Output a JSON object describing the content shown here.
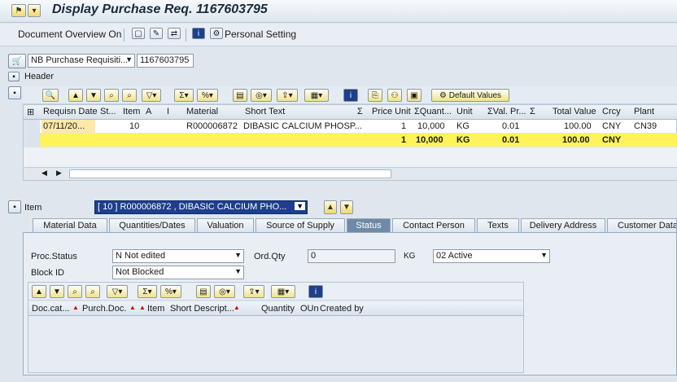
{
  "window": {
    "title": "Display Purchase Req. 1167603795"
  },
  "appbar": {
    "doc_overview": "Document Overview On",
    "personal_setting": "Personal Setting"
  },
  "header": {
    "doc_type": "NB Purchase Requisiti...",
    "doc_number": "1167603795",
    "header_label": "Header"
  },
  "alv": {
    "default_values": "Default Values"
  },
  "grid": {
    "columns": [
      "Requisn Date",
      "St...",
      "Item",
      "A",
      "I",
      "Material",
      "Short Text",
      "Σ",
      "Price Unit",
      "ΣQuant...",
      "Unit",
      "ΣVal. Pr...",
      "Σ",
      "Total Value",
      "Crcy",
      "Plant"
    ],
    "rows": [
      {
        "date": "07/11/20...",
        "item": "10",
        "material": "R000006872",
        "short_text": "DIBASIC CALCIUM PHOSP...",
        "price_unit": "1",
        "quantity": "10,000",
        "unit": "KG",
        "val_price": "0.01",
        "total_value": "100.00",
        "currency": "CNY",
        "plant": "CN39"
      }
    ],
    "totals": {
      "price_unit": "1",
      "quantity": "10,000",
      "unit": "KG",
      "val_price": "0.01",
      "total_value": "100.00",
      "currency": "CNY"
    }
  },
  "item": {
    "label": "Item",
    "selected": "[ 10 ] R000006872 , DIBASIC CALCIUM PHO..."
  },
  "tabs": [
    "Material Data",
    "Quantities/Dates",
    "Valuation",
    "Source of Supply",
    "Status",
    "Contact Person",
    "Texts",
    "Delivery Address",
    "Customer Data"
  ],
  "status": {
    "proc_status_label": "Proc.Status",
    "proc_status_value": "N Not edited",
    "ord_qty_label": "Ord.Qty",
    "ord_qty_value": "0",
    "ord_qty_unit": "KG",
    "release_value": "02 Active",
    "block_id_label": "Block ID",
    "block_id_value": "Not Blocked"
  },
  "subgrid": {
    "columns": [
      "Doc.cat...",
      "Purch.Doc.",
      "Item",
      "Short Descript...",
      "Quantity",
      "OUn",
      "Created by"
    ]
  }
}
